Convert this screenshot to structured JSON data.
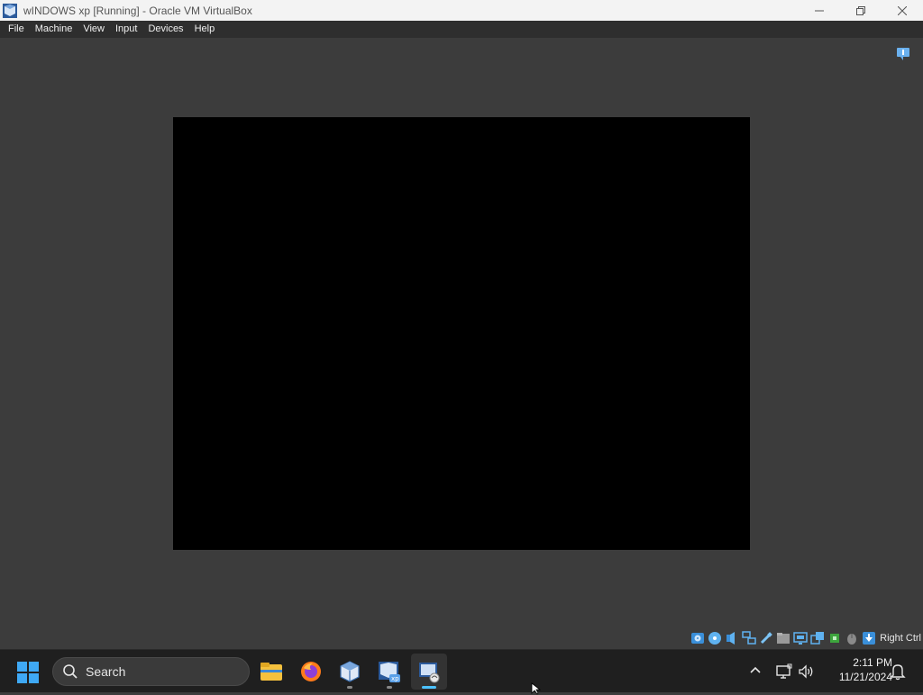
{
  "window": {
    "title": "wINDOWS xp [Running] - Oracle VM VirtualBox",
    "controls": [
      "minimize-icon",
      "restore-icon",
      "close-icon"
    ]
  },
  "menu": {
    "items": [
      "File",
      "Machine",
      "View",
      "Input",
      "Devices",
      "Help"
    ]
  },
  "vm": {
    "screen_state": "black",
    "status_icons": [
      "hard-disk-icon",
      "optical-drive-icon",
      "audio-icon",
      "network-icon",
      "usb-icon",
      "shared-folders-icon",
      "display-icon",
      "recording-icon",
      "cpu-icon",
      "mouse-integration-icon",
      "keyboard-icon"
    ],
    "host_key": "Right Ctrl"
  },
  "taskbar": {
    "search_label": "Search",
    "apps": [
      "file-explorer-icon",
      "firefox-icon",
      "virtualbox-icon",
      "windows-xp-vm-icon",
      "virtualbox-vm-window-icon"
    ],
    "clock_time": "2:11 PM",
    "clock_date": "11/21/2024"
  },
  "colors": {
    "accent": "#4cc2ff",
    "vm_background": "#3c3c3c",
    "taskbar": "#1f1f1f"
  }
}
